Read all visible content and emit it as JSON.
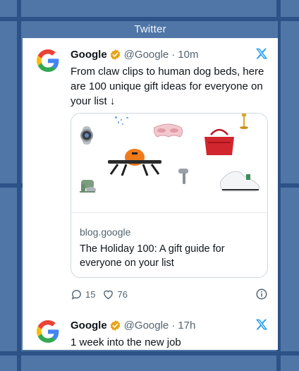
{
  "widget": {
    "title": "Twitter"
  },
  "tweets": [
    {
      "name": "Google",
      "handle": "@Google",
      "separator": "·",
      "time": "10m",
      "text": "From claw clips to human dog beds, here are 100 unique gift ideas for everyone on your list ↓",
      "card": {
        "domain": "blog.google",
        "title": "The Holiday 100: A gift guide for everyone on your list"
      },
      "replies": "15",
      "likes": "76"
    },
    {
      "name": "Google",
      "handle": "@Google",
      "separator": "·",
      "time": "17h",
      "text": "1 week into the new job"
    }
  ],
  "icons": {
    "avatar": "google-g-logo",
    "verified": "verified-badge-icon",
    "brand": "x-logo-icon",
    "reply": "reply-icon",
    "like": "heart-icon",
    "info": "info-icon"
  },
  "colors": {
    "background": "#4f76a6",
    "grid_lines": "#2c5288",
    "verified_gold": "#e8a317",
    "x_logo": "#1d9bf0",
    "text_primary": "#0f1419",
    "text_secondary": "#536471"
  }
}
